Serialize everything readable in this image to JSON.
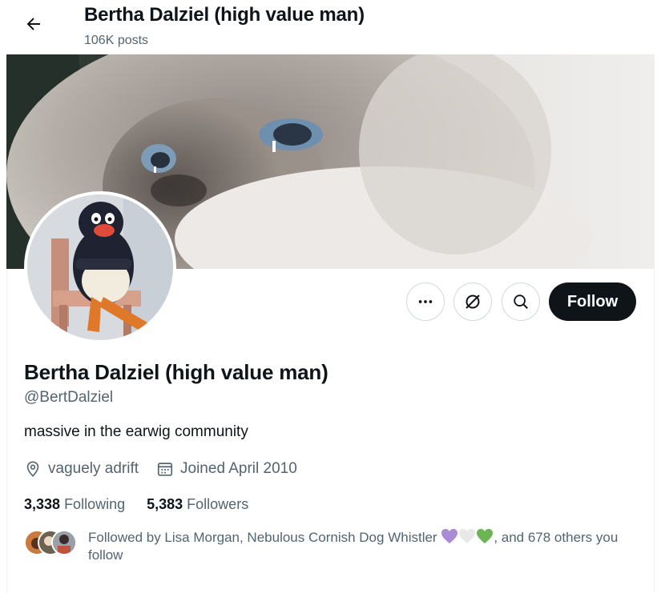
{
  "header": {
    "title": "Bertha Dalziel (high value man)",
    "posts": "106K posts"
  },
  "actions": {
    "follow_label": "Follow"
  },
  "profile": {
    "name": "Bertha Dalziel (high value man)",
    "handle": "@BertDalziel",
    "bio": "massive in the earwig community",
    "location": "vaguely adrift",
    "joined": "Joined April 2010"
  },
  "stats": {
    "following_count": "3,338",
    "following_label": "Following",
    "followers_count": "5,383",
    "followers_label": "Followers"
  },
  "followed_by": {
    "prefix": "Followed by Lisa Morgan, Nebulous Cornish Dog Whistler ",
    "suffix": ", and 678 others you follow",
    "hearts": [
      "#a98bd6",
      "#e8e8e8",
      "#6cb552"
    ]
  },
  "icons": [
    "back-arrow-icon",
    "more-icon",
    "grok-icon",
    "search-icon",
    "location-icon",
    "calendar-icon"
  ]
}
